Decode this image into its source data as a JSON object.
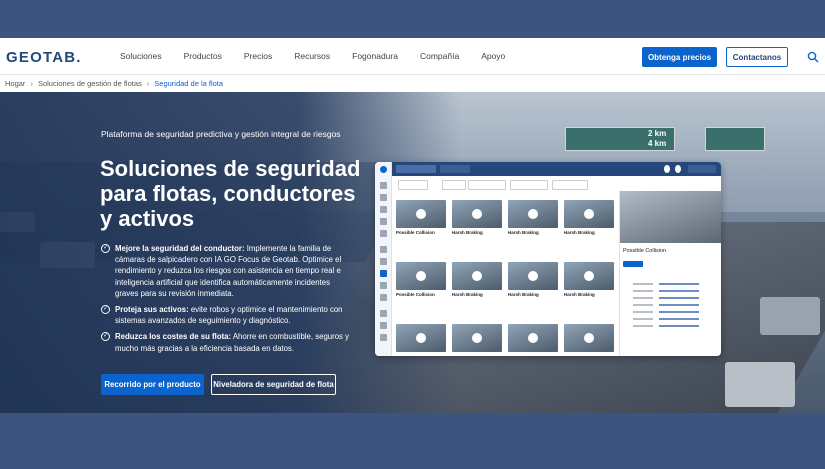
{
  "brand": {
    "logo": "GEOTAB.",
    "accent": "#0b63ce",
    "navy": "#25477b"
  },
  "nav": {
    "items": [
      "Soluciones",
      "Productos",
      "Precios",
      "Recursos",
      "Fogonadura",
      "Compañía",
      "Apoyo"
    ],
    "cta_primary": "Obtenga precios",
    "cta_secondary": "Contactanos",
    "search_icon": "search-icon"
  },
  "breadcrumb": {
    "items": [
      "Hogar",
      "Soluciones de gestión de flotas",
      "Seguridad de la flota"
    ]
  },
  "hero": {
    "eyebrow": "Plataforma de seguridad predictiva y gestión integral de riesgos",
    "title": "Soluciones de seguridad para flotas, conductores y activos",
    "bullets": [
      {
        "bold": "Mejore la seguridad del conductor:",
        "text": " Implemente la familia de cámaras de salpicadero con IA GO Focus de Geotab. Optimice el rendimiento y reduzca los riesgos con asistencia en tiempo real e inteligencia artificial que identifica automáticamente incidentes graves para su revisión inmediata."
      },
      {
        "bold": "Proteja sus activos:",
        "text": " evite robos y optimice el mantenimiento con sistemas avanzados de seguimiento y diagnóstico."
      },
      {
        "bold": "Reduzca los costes de su flota:",
        "text": " Ahorre en combustible, seguros y mucho más gracias a la eficiencia basada en datos."
      }
    ],
    "btn_primary": "Recorrido por el producto",
    "btn_secondary": "Niveladora de seguridad de flota",
    "road_sign": "2 km\n4 km"
  },
  "mock": {
    "tiles": [
      {
        "caption": "Possible Collision"
      },
      {
        "caption": "Harsh Braking"
      },
      {
        "caption": "Harsh Braking"
      },
      {
        "caption": "Harsh Braking"
      },
      {
        "caption": "Possible Collision"
      },
      {
        "caption": "Harsh Braking"
      },
      {
        "caption": "Harsh Braking"
      },
      {
        "caption": "Harsh Braking"
      }
    ],
    "panel_title": "Possible Collision"
  }
}
